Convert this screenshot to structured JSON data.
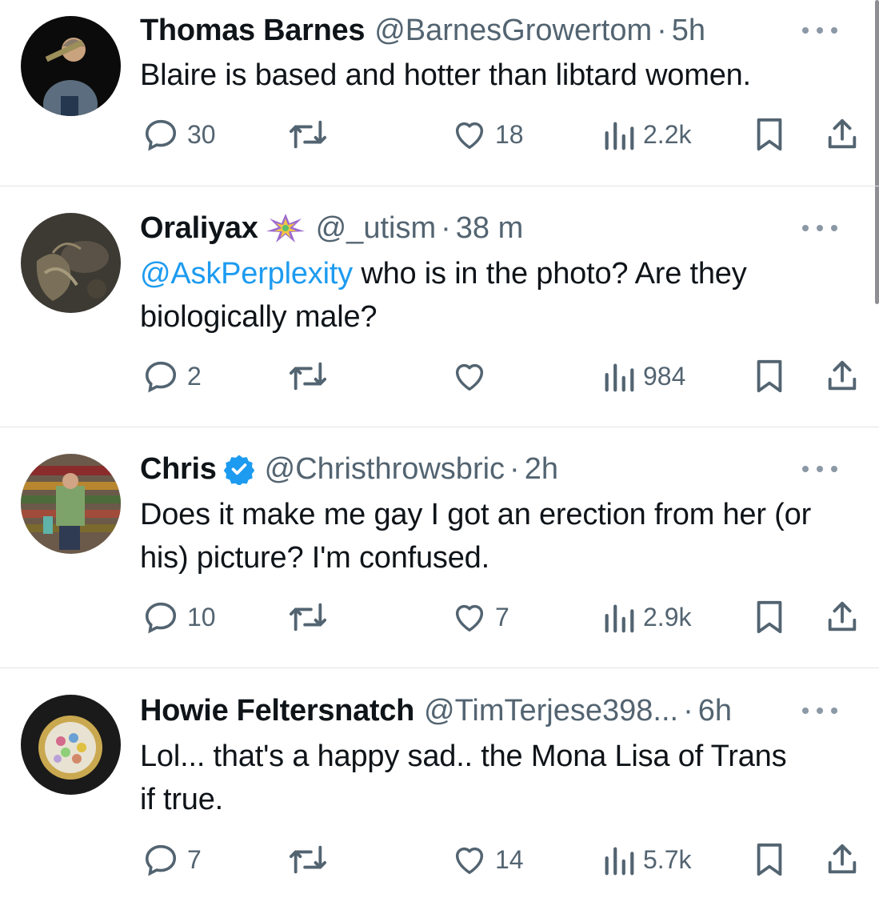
{
  "tweets": [
    {
      "name": "Thomas Barnes",
      "handle": "@BarnesGrowertom",
      "dot": "·",
      "time": "5h",
      "verified": false,
      "emoji_badge": false,
      "text_mention": "",
      "text": "Blaire is based and hotter than libtard women.",
      "replies": "30",
      "reposts": "",
      "likes": "18",
      "views": "2.2k"
    },
    {
      "name": "Oraliyax",
      "handle": "@_utism",
      "dot": "·",
      "time": "38 m",
      "verified": false,
      "emoji_badge": true,
      "text_mention": "@AskPerplexity",
      "text": " who is in the photo? Are they biologically male?",
      "replies": "2",
      "reposts": "",
      "likes": "",
      "views": "984"
    },
    {
      "name": "Chris",
      "handle": "@Christhrowsbric",
      "dot": "·",
      "time": "2h",
      "verified": true,
      "emoji_badge": false,
      "text_mention": "",
      "text": "Does it make me gay I got an erection from her (or his) picture? I'm confused.",
      "replies": "10",
      "reposts": "",
      "likes": "7",
      "views": "2.9k"
    },
    {
      "name": "Howie Feltersnatch",
      "handle": "@TimTerjese398...",
      "dot": "·",
      "time": "6h",
      "verified": false,
      "emoji_badge": false,
      "text_mention": "",
      "text": "Lol... that's a happy sad.. the Mona Lisa of Trans if true.",
      "replies": "7",
      "reposts": "",
      "likes": "14",
      "views": "5.7k"
    }
  ],
  "colors": {
    "text": "#0f1419",
    "muted": "#536471",
    "link": "#1d9bf0",
    "divider": "#e1e4e8",
    "verified": "#1d9bf0"
  },
  "icons": [
    "reply-icon",
    "repost-icon",
    "like-icon",
    "views-icon",
    "bookmark-icon",
    "share-icon",
    "more-icon",
    "verified-badge-icon",
    "pinata-emoji-icon"
  ]
}
